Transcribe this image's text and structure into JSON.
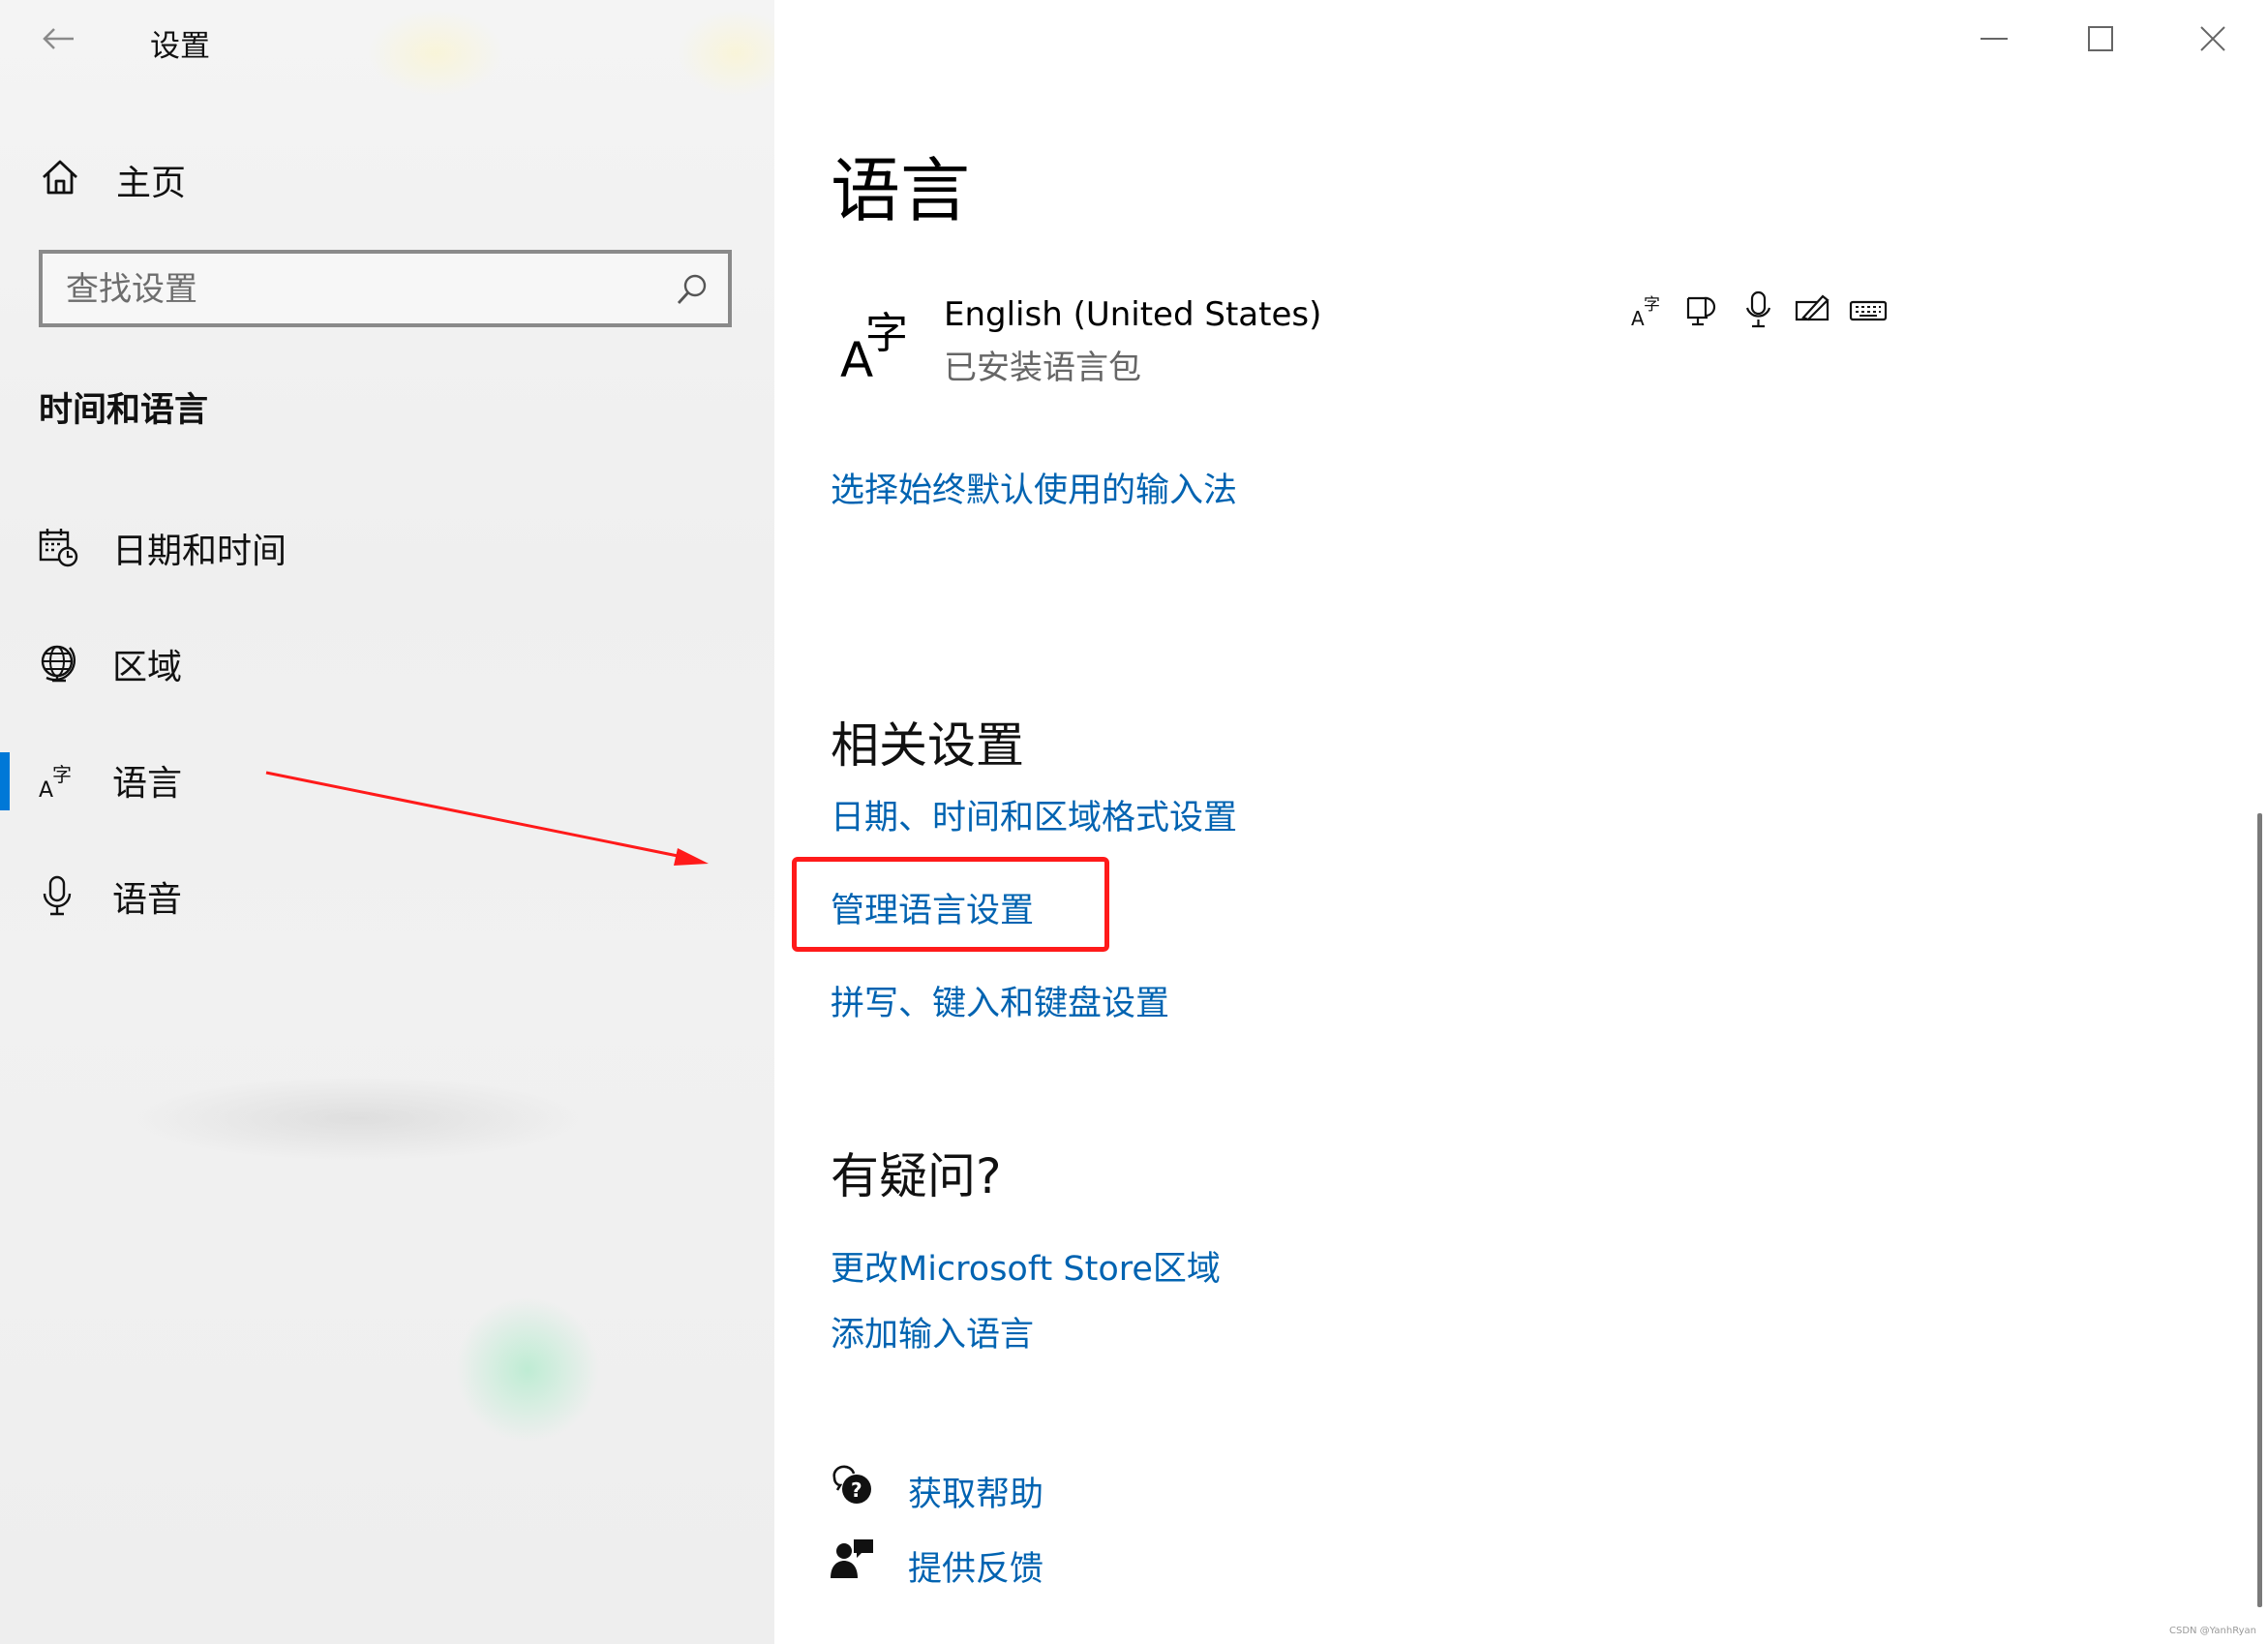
{
  "window": {
    "title": "设置",
    "controls": [
      "minimize",
      "maximize",
      "close"
    ]
  },
  "sidebar": {
    "home_label": "主页",
    "search": {
      "placeholder": "查找设置",
      "value": ""
    },
    "section_title": "时间和语言",
    "items": [
      {
        "label": "日期和时间",
        "icon": "calendar-clock-icon",
        "active": false
      },
      {
        "label": "区域",
        "icon": "globe-icon",
        "active": false
      },
      {
        "label": "语言",
        "icon": "language-icon",
        "active": true
      },
      {
        "label": "语音",
        "icon": "microphone-icon",
        "active": false
      }
    ]
  },
  "main": {
    "title": "语言",
    "language": {
      "name": "English (United States)",
      "status": "已安装语言包",
      "features": [
        "display-language-icon",
        "text-to-speech-icon",
        "speech-recognition-icon",
        "handwriting-icon",
        "keyboard-icon"
      ]
    },
    "default_input_link": "选择始终默认使用的输入法",
    "related": {
      "heading": "相关设置",
      "links": [
        "日期、时间和区域格式设置",
        "管理语言设置",
        "拼写、键入和键盘设置"
      ]
    },
    "questions": {
      "heading": "有疑问?",
      "links": [
        "更改Microsoft Store区域",
        "添加输入语言"
      ]
    },
    "help": {
      "get_help": "获取帮助",
      "feedback": "提供反馈"
    }
  },
  "annotation": {
    "highlight_color": "#ff1a1a",
    "highlighted_item": "管理语言设置"
  },
  "watermark": "CSDN @YanhRyan",
  "colors": {
    "accent": "#0078d7",
    "link": "#0063b1",
    "sidebar_bg": "#f2f2f2"
  }
}
